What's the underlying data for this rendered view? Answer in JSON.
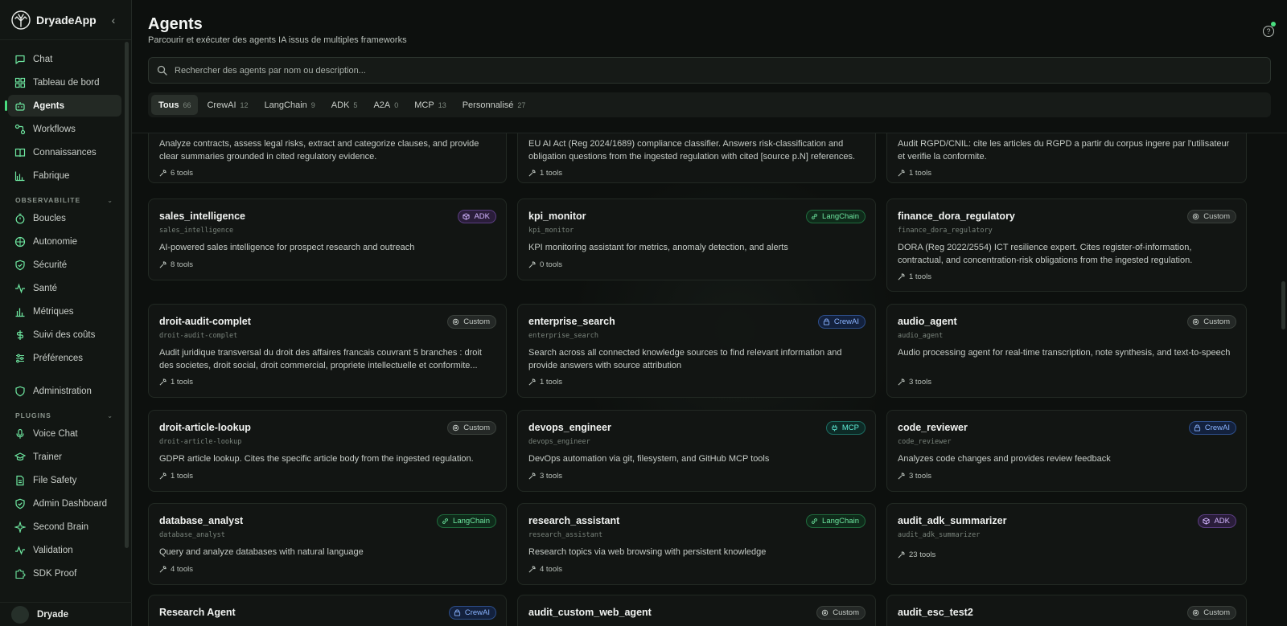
{
  "app": {
    "name": "DryadeApp"
  },
  "sidebar": {
    "items": [
      {
        "label": "Chat",
        "icon": "chat-icon"
      },
      {
        "label": "Tableau de bord",
        "icon": "dashboard-icon"
      },
      {
        "label": "Agents",
        "icon": "bot-icon",
        "active": true
      },
      {
        "label": "Workflows",
        "icon": "workflow-icon"
      },
      {
        "label": "Connaissances",
        "icon": "book-icon"
      },
      {
        "label": "Fabrique",
        "icon": "factory-icon"
      }
    ],
    "observability_title": "OBSERVABILITE",
    "observability_items": [
      {
        "label": "Boucles",
        "icon": "timer-icon"
      },
      {
        "label": "Autonomie",
        "icon": "globe-icon"
      },
      {
        "label": "Sécurité",
        "icon": "shield-icon"
      },
      {
        "label": "Santé",
        "icon": "pulse-icon"
      },
      {
        "label": "Métriques",
        "icon": "bar-chart-icon"
      },
      {
        "label": "Suivi des coûts",
        "icon": "dollar-icon"
      },
      {
        "label": "Préférences",
        "icon": "sliders-icon"
      }
    ],
    "admin_item": {
      "label": "Administration",
      "icon": "shield-icon"
    },
    "plugins_title": "PLUGINS",
    "plugin_items": [
      {
        "label": "Voice Chat",
        "icon": "mic-icon"
      },
      {
        "label": "Trainer",
        "icon": "graduation-cap-icon"
      },
      {
        "label": "File Safety",
        "icon": "file-icon"
      },
      {
        "label": "Admin Dashboard",
        "icon": "shield-check-icon"
      },
      {
        "label": "Second Brain",
        "icon": "sparkle-icon"
      },
      {
        "label": "Validation",
        "icon": "activity-icon"
      },
      {
        "label": "SDK Proof",
        "icon": "puzzle-icon"
      }
    ],
    "user": {
      "name": "Dryade"
    }
  },
  "header": {
    "title": "Agents",
    "subtitle": "Parcourir et exécuter des agents IA issus de multiples frameworks"
  },
  "search": {
    "placeholder": "Rechercher des agents par nom ou description..."
  },
  "tabs": [
    {
      "label": "Tous",
      "count": "66",
      "active": true
    },
    {
      "label": "CrewAI",
      "count": "12"
    },
    {
      "label": "LangChain",
      "count": "9"
    },
    {
      "label": "ADK",
      "count": "5"
    },
    {
      "label": "A2A",
      "count": "0"
    },
    {
      "label": "MCP",
      "count": "13"
    },
    {
      "label": "Personnalisé",
      "count": "27"
    }
  ],
  "colors": {
    "accent": "#4ade80",
    "custom": "#c6ccc7",
    "adk": "#d3b6ff",
    "langchain": "#6ee7a0",
    "crewai": "#8ab4ff",
    "mcp": "#5eead4"
  },
  "agents": [
    {
      "name": "",
      "id": "",
      "badge": "",
      "type": "",
      "description": "Analyze contracts, assess legal risks, extract and categorize clauses, and provide clear summaries grounded in cited regulatory evidence.",
      "tools": "6 tools"
    },
    {
      "name": "",
      "id": "",
      "badge": "",
      "type": "",
      "description": "EU AI Act (Reg 2024/1689) compliance classifier. Answers risk-classification and obligation questions from the ingested regulation with cited [source p.N] references.",
      "tools": "1 tools"
    },
    {
      "name": "",
      "id": "",
      "badge": "",
      "type": "",
      "description": "Audit RGPD/CNIL: cite les articles du RGPD a partir du corpus ingere par l'utilisateur et verifie la conformite.",
      "tools": "1 tools"
    },
    {
      "name": "sales_intelligence",
      "id": "sales_intelligence",
      "badge": "ADK",
      "type": "adk",
      "description": "AI-powered sales intelligence for prospect research and outreach",
      "tools": "8 tools"
    },
    {
      "name": "kpi_monitor",
      "id": "kpi_monitor",
      "badge": "LangChain",
      "type": "langchain",
      "description": "KPI monitoring assistant for metrics, anomaly detection, and alerts",
      "tools": "0 tools"
    },
    {
      "name": "finance_dora_regulatory",
      "id": "finance_dora_regulatory",
      "badge": "Custom",
      "type": "custom",
      "description": "DORA (Reg 2022/2554) ICT resilience expert. Cites register-of-information, contractual, and concentration-risk obligations from the ingested regulation.",
      "tools": "1 tools"
    },
    {
      "name": "droit-audit-complet",
      "id": "droit-audit-complet",
      "badge": "Custom",
      "type": "custom",
      "description": "Audit juridique transversal du droit des affaires francais couvrant 5 branches : droit des societes, droit social, droit commercial, propriete intellectuelle et conformite...",
      "tools": "1 tools"
    },
    {
      "name": "enterprise_search",
      "id": "enterprise_search",
      "badge": "CrewAI",
      "type": "crewai",
      "description": "Search across all connected knowledge sources to find relevant information and provide answers with source attribution",
      "tools": "1 tools"
    },
    {
      "name": "audio_agent",
      "id": "audio_agent",
      "badge": "Custom",
      "type": "custom",
      "description": "Audio processing agent for real-time transcription, note synthesis, and text-to-speech",
      "tools": "3 tools"
    },
    {
      "name": "droit-article-lookup",
      "id": "droit-article-lookup",
      "badge": "Custom",
      "type": "custom",
      "description": "GDPR article lookup. Cites the specific article body from the ingested regulation.",
      "tools": "1 tools"
    },
    {
      "name": "devops_engineer",
      "id": "devops_engineer",
      "badge": "MCP",
      "type": "mcp",
      "description": "DevOps automation via git, filesystem, and GitHub MCP tools",
      "tools": "3 tools"
    },
    {
      "name": "code_reviewer",
      "id": "code_reviewer",
      "badge": "CrewAI",
      "type": "crewai",
      "description": "Analyzes code changes and provides review feedback",
      "tools": "3 tools"
    },
    {
      "name": "database_analyst",
      "id": "database_analyst",
      "badge": "LangChain",
      "type": "langchain",
      "description": "Query and analyze databases with natural language",
      "tools": "4 tools"
    },
    {
      "name": "research_assistant",
      "id": "research_assistant",
      "badge": "LangChain",
      "type": "langchain",
      "description": "Research topics via web browsing with persistent knowledge",
      "tools": "4 tools"
    },
    {
      "name": "audit_adk_summarizer",
      "id": "audit_adk_summarizer",
      "badge": "ADK",
      "type": "adk",
      "description": "",
      "tools": "23 tools"
    },
    {
      "name": "Research Agent",
      "id": "",
      "badge": "CrewAI",
      "type": "crewai",
      "description": "",
      "tools": ""
    },
    {
      "name": "audit_custom_web_agent",
      "id": "",
      "badge": "Custom",
      "type": "custom",
      "description": "",
      "tools": ""
    },
    {
      "name": "audit_esc_test2",
      "id": "",
      "badge": "Custom",
      "type": "custom",
      "description": "",
      "tools": ""
    }
  ]
}
